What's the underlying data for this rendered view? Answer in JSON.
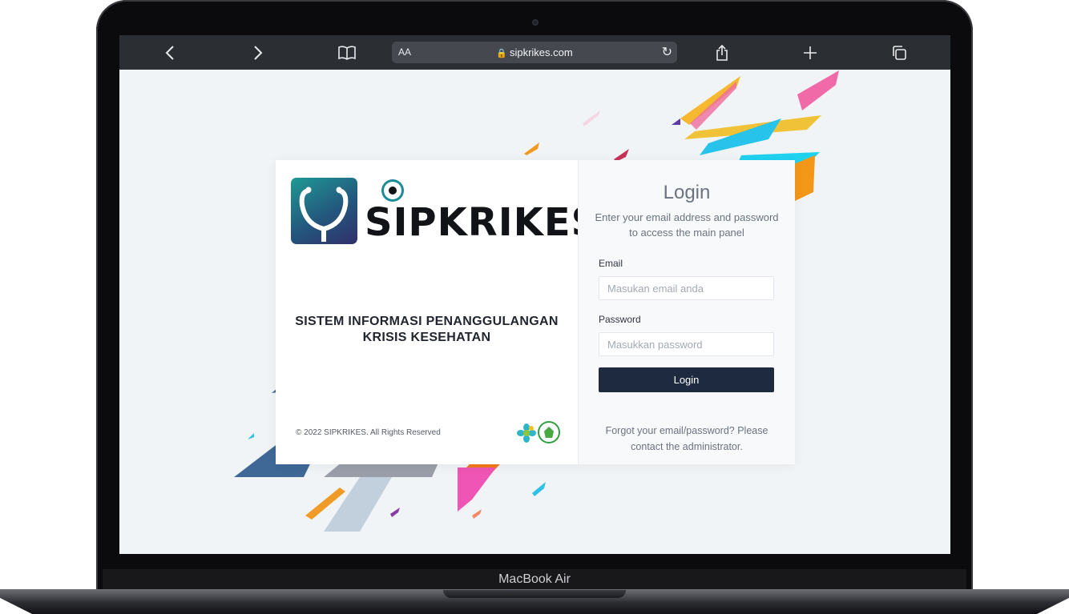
{
  "browser": {
    "url": "sipkrikes.com",
    "text_size_label": "AA",
    "icons": {
      "back": "chevron-left-icon",
      "forward": "chevron-right-icon",
      "bookmarks": "book-icon",
      "reload": "reload-icon",
      "share": "share-icon",
      "new_tab": "plus-icon",
      "tabs": "tabs-icon"
    }
  },
  "device": {
    "model": "MacBook Air"
  },
  "brand": {
    "name": "SIPKRIKES",
    "subtitle_line1": "SISTEM INFORMASI PENANGGULANGAN",
    "subtitle_line2": "KRISIS KESEHATAN",
    "copyright": "© 2022 SIPKRIKES. All Rights Reserved",
    "colors": {
      "logo_teal": "#1f9a95",
      "logo_navy": "#312f6b"
    }
  },
  "login": {
    "title": "Login",
    "description": "Enter your email address and password to access the main panel",
    "email_label": "Email",
    "email_placeholder": "Masukan email anda",
    "password_label": "Password",
    "password_placeholder": "Masukkan password",
    "submit_label": "Login",
    "forgot_text": "Forgot your email/password? Please contact the administrator.",
    "colors": {
      "button": "#1e2a3f"
    }
  }
}
